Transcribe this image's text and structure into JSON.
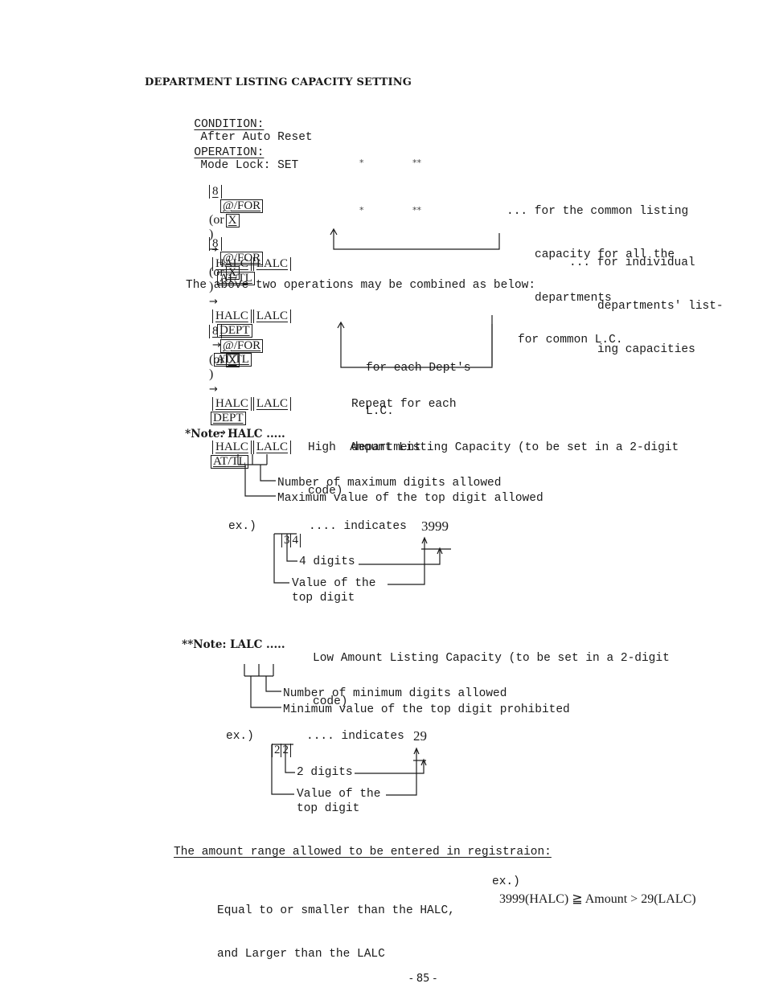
{
  "heading": "DEPARTMENT LISTING CAPACITY SETTING",
  "condition": {
    "label": "CONDITION:",
    "value": "After Auto Reset"
  },
  "operation": {
    "label": "OPERATION:",
    "value": "Mode Lock: SET"
  },
  "keys": {
    "num8": "8",
    "at_for": "@/FOR",
    "or_open": "(or",
    "x": "X",
    "close": ")",
    "halc": "HALC",
    "lalc": "LALC",
    "at_tl": "AT/TL",
    "dept": "DEPT",
    "star1": "*",
    "star2": "**",
    "arrow": "→"
  },
  "seq1": {
    "desc": [
      "... for the common listing",
      "capacity for all the",
      "departments"
    ]
  },
  "seq2": {
    "desc": [
      "... for individual",
      "departments' list-",
      "ing capacities"
    ]
  },
  "combined": {
    "intro": "The above two operations may be combined as below:",
    "loop_note": [
      "for each Dept's",
      "L.C."
    ],
    "common_note": "for common L.C.",
    "repeat_note": [
      "Repeat for each",
      "department"
    ]
  },
  "note_halc": {
    "label": "*Note: HALC .....",
    "text": [
      "High  Amount Listing Capacity (to be set in a 2-digit",
      "code)"
    ],
    "legend": [
      "Number of maximum digits allowed",
      "Maximum value of the top digit allowed"
    ],
    "example": {
      "prefix": "ex.)",
      "digits": [
        "3",
        "4"
      ],
      "indicates": ".... indicates",
      "result": "3999",
      "label_digits": "4 digits",
      "label_value": [
        "Value of the",
        "top digit"
      ]
    }
  },
  "note_lalc": {
    "label": "**Note: LALC .....",
    "text": [
      "Low Amount Listing Capacity (to be set in a 2-digit",
      "code)"
    ],
    "legend": [
      "Number of minimum digits allowed",
      "Minimum value of the top digit prohibited"
    ],
    "example": {
      "prefix": "ex.)",
      "digits": [
        "2",
        "2"
      ],
      "indicates": ".... indicates",
      "result": "29",
      "label_digits": "2 digits",
      "label_value": [
        "Value of the",
        "top digit"
      ]
    }
  },
  "range": {
    "heading": "The amount range allowed to be entered in registraion:",
    "rule": [
      "Equal to or smaller than the HALC,",
      "and Larger than the LALC"
    ],
    "ex_label": "ex.)",
    "ex_value": "3999(HALC) ≧ Amount > 29(LALC)"
  },
  "page_number": "- 85 -"
}
